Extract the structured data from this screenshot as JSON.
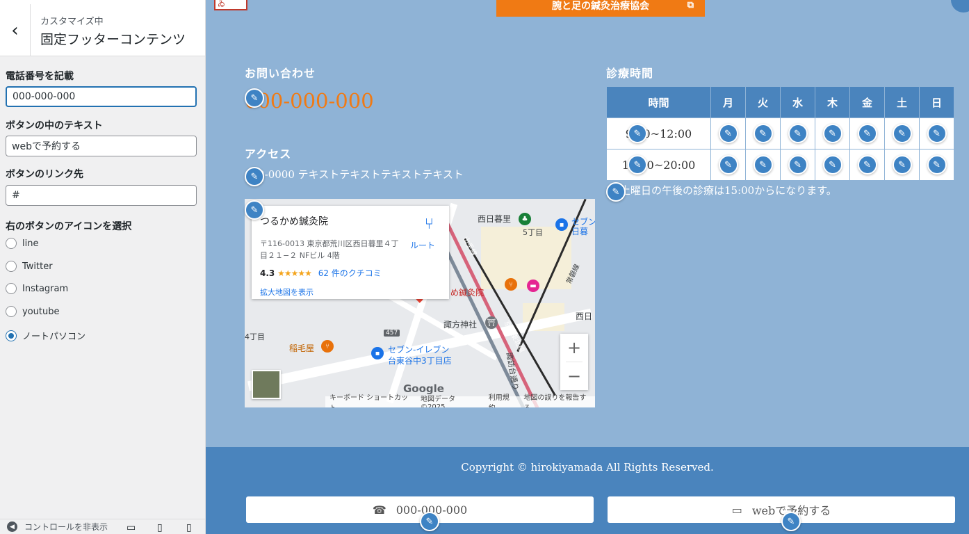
{
  "customizer": {
    "subtitle": "カスタマイズ中",
    "title": "固定フッターコンテンツ",
    "fields": {
      "phone_label": "電話番号を記載",
      "phone_value": "000-000-000",
      "button_text_label": "ボタンの中のテキスト",
      "button_text_value": "webで予約する",
      "button_link_label": "ボタンのリンク先",
      "button_link_value": "#",
      "icon_label": "右のボタンのアイコンを選択"
    },
    "icon_options": [
      "line",
      "Twitter",
      "Instagram",
      "youtube",
      "ノートパソコン"
    ],
    "icon_selected": "ノートパソコン",
    "hide_controls": "コントロールを非表示"
  },
  "preview": {
    "top_button": "腕と足の鍼灸治療協会",
    "contact": {
      "title": "お問い合わせ",
      "phone": "000-000-000"
    },
    "access": {
      "title": "アクセス",
      "address": "000-0000 テキストテキストテキストテキスト"
    },
    "map": {
      "place_name": "つるかめ鍼灸院",
      "address": "〒116-0013 東京都荒川区西日暮里４丁目２１−２ NFビル 4階",
      "rating": "4.3",
      "stars": "★★★★★",
      "reviews": "62 件のクチコミ",
      "route": "ルート",
      "view_larger": "拡大地図を表示",
      "labels": {
        "nishinippori": "西日暮里",
        "go_chome": "5丁目",
        "seven1": "セブン",
        "seven1b": "日暮",
        "clinic": "め鍼灸院",
        "suwa": "諏方神社",
        "yon_chome": "4丁目",
        "inageya": "稲毛屋",
        "seven2": "セブン-イレブン",
        "seven2b": "台東谷中3丁目店",
        "route457": "457",
        "nishi2": "西日",
        "suwadai": "諏訪台通り",
        "yamanote": "山手線",
        "keihin": "京浜東北線",
        "joban": "常磐線"
      },
      "google": "Google",
      "footer": [
        "キーボード ショートカット",
        "地図データ ©2025",
        "利用規約",
        "地図の誤りを報告する"
      ]
    },
    "hours": {
      "title": "診療時間",
      "headers": [
        "時間",
        "月",
        "火",
        "水",
        "木",
        "金",
        "土",
        "日"
      ],
      "rows": [
        "9:00~12:00",
        "15:00~20:00"
      ],
      "note": "土曜日の午後の診療は15:00からになります。"
    },
    "footer": {
      "copyright": "Copyright © hirokiyamada All Rights Reserved.",
      "phone_button": "000-000-000",
      "web_button": "webで予約する"
    }
  },
  "colors": {
    "accent_orange": "#f07a14",
    "footer_blue": "#4a84bd",
    "page_blue": "#8fb3d6",
    "wp_blue": "#2271b1"
  }
}
